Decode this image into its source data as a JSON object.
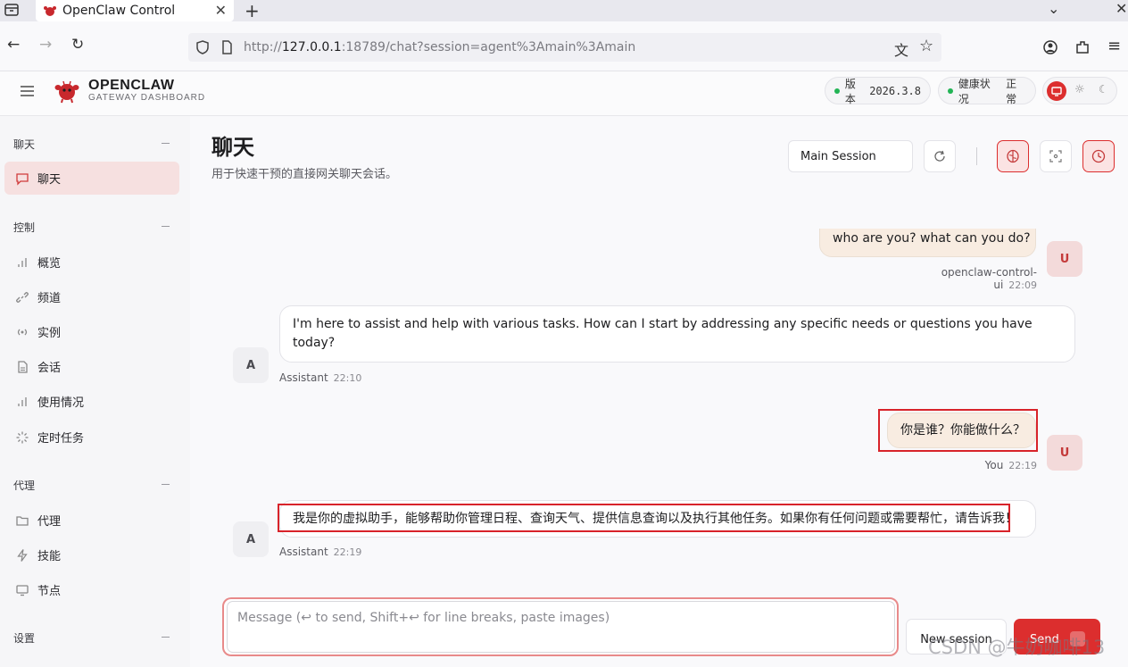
{
  "browser": {
    "tab_title": "OpenClaw Control",
    "url_prefix": "http://",
    "url_host": "127.0.0.1",
    "url_rest": ":18789/chat?session=agent%3Amain%3Amain"
  },
  "header": {
    "brand": "OPENCLAW",
    "brand_sub": "GATEWAY DASHBOARD",
    "version_label": "版本",
    "version_value": "2026.3.8",
    "health_label": "健康状况",
    "health_value": "正常"
  },
  "sidebar": {
    "sections": [
      {
        "title": "聊天",
        "items": [
          {
            "label": "聊天",
            "icon": "message-icon"
          }
        ]
      },
      {
        "title": "控制",
        "items": [
          {
            "label": "概览",
            "icon": "bar-chart-icon"
          },
          {
            "label": "频道",
            "icon": "link-icon"
          },
          {
            "label": "实例",
            "icon": "broadcast-icon"
          },
          {
            "label": "会话",
            "icon": "document-icon"
          },
          {
            "label": "使用情况",
            "icon": "bar-chart-icon"
          },
          {
            "label": "定时任务",
            "icon": "loader-icon"
          }
        ]
      },
      {
        "title": "代理",
        "items": [
          {
            "label": "代理",
            "icon": "folder-icon"
          },
          {
            "label": "技能",
            "icon": "bolt-icon"
          },
          {
            "label": "节点",
            "icon": "monitor-icon"
          }
        ]
      },
      {
        "title": "设置",
        "items": []
      }
    ]
  },
  "main": {
    "title": "聊天",
    "subtitle": "用于快速干预的直接网关聊天会话。",
    "session_select": "Main Session"
  },
  "messages": [
    {
      "role": "user",
      "text": "who are you? what can you do?",
      "sender": "openclaw-control-ui",
      "time": "22:09",
      "avatar": "U"
    },
    {
      "role": "assistant",
      "text": "I'm here to assist and help with various tasks. How can I start by addressing any specific needs or questions you have today?",
      "sender": "Assistant",
      "time": "22:10",
      "avatar": "A"
    },
    {
      "role": "user",
      "text": "你是谁？你能做什么？",
      "sender": "You",
      "time": "22:19",
      "avatar": "U"
    },
    {
      "role": "assistant",
      "text": "我是你的虚拟助手，能够帮助你管理日程、查询天气、提供信息查询以及执行其他任务。如果你有任何问题或需要帮忙，请告诉我！",
      "sender": "Assistant",
      "time": "22:19",
      "avatar": "A"
    }
  ],
  "composer": {
    "placeholder": "Message (↩ to send, Shift+↩ for line breaks, paste images)",
    "new_session": "New session",
    "send": "Send"
  },
  "watermark": "CSDN @牛奶咖啡13",
  "colors": {
    "accent": "#dc2e2e",
    "user_bubble": "#f8ece1",
    "status_ok": "#22b455"
  }
}
